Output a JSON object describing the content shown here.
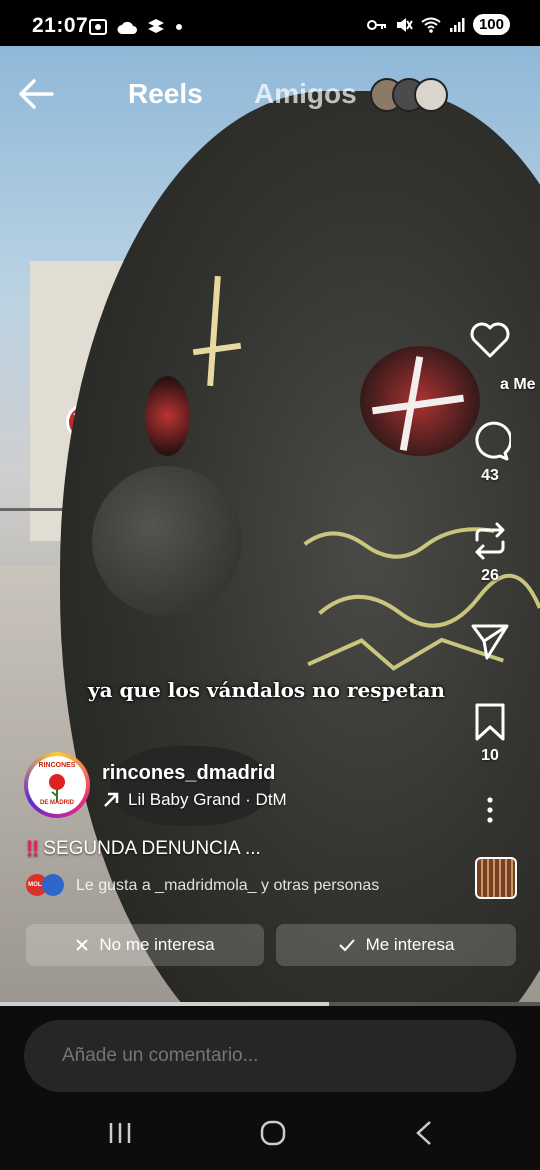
{
  "status": {
    "time": "21:07",
    "battery": "100"
  },
  "nav": {
    "tab_reels": "Reels",
    "tab_amigos": "Amigos"
  },
  "actions": {
    "likes": "a Me g",
    "comments": "43",
    "reposts": "26",
    "saves": "10"
  },
  "subtitle": "ya que los vándalos no respetan",
  "post": {
    "username": "rincones_dmadrid",
    "audio": "Lil Baby Grand · DtM",
    "caption_mark": "‼",
    "caption": "SEGUNDA DENUNCIA ...",
    "liked_by": "Le gusta a _madridmola_ y otras personas",
    "avatar_top": "RINCONES",
    "avatar_bottom": "DE MADRID",
    "liked_av_text": "MOLA"
  },
  "buttons": {
    "not_interested": "No me interesa",
    "interested": "Me interesa"
  },
  "progress": 0.61,
  "comment": {
    "placeholder": "Añade un comentario..."
  },
  "icons": {
    "status": [
      "screenshot-icon",
      "cloud-icon",
      "dropbox-icon",
      "dot-icon",
      "key-icon",
      "mute-icon",
      "wifi-icon",
      "signal-icon"
    ],
    "actions": [
      "heart-icon",
      "comment-icon",
      "repost-icon",
      "share-icon",
      "bookmark-icon",
      "more-icon"
    ]
  },
  "colors": {
    "accent_ring": [
      "#f9ce34",
      "#ee2a7b",
      "#6228d7"
    ],
    "background": "#0d0d0d"
  }
}
